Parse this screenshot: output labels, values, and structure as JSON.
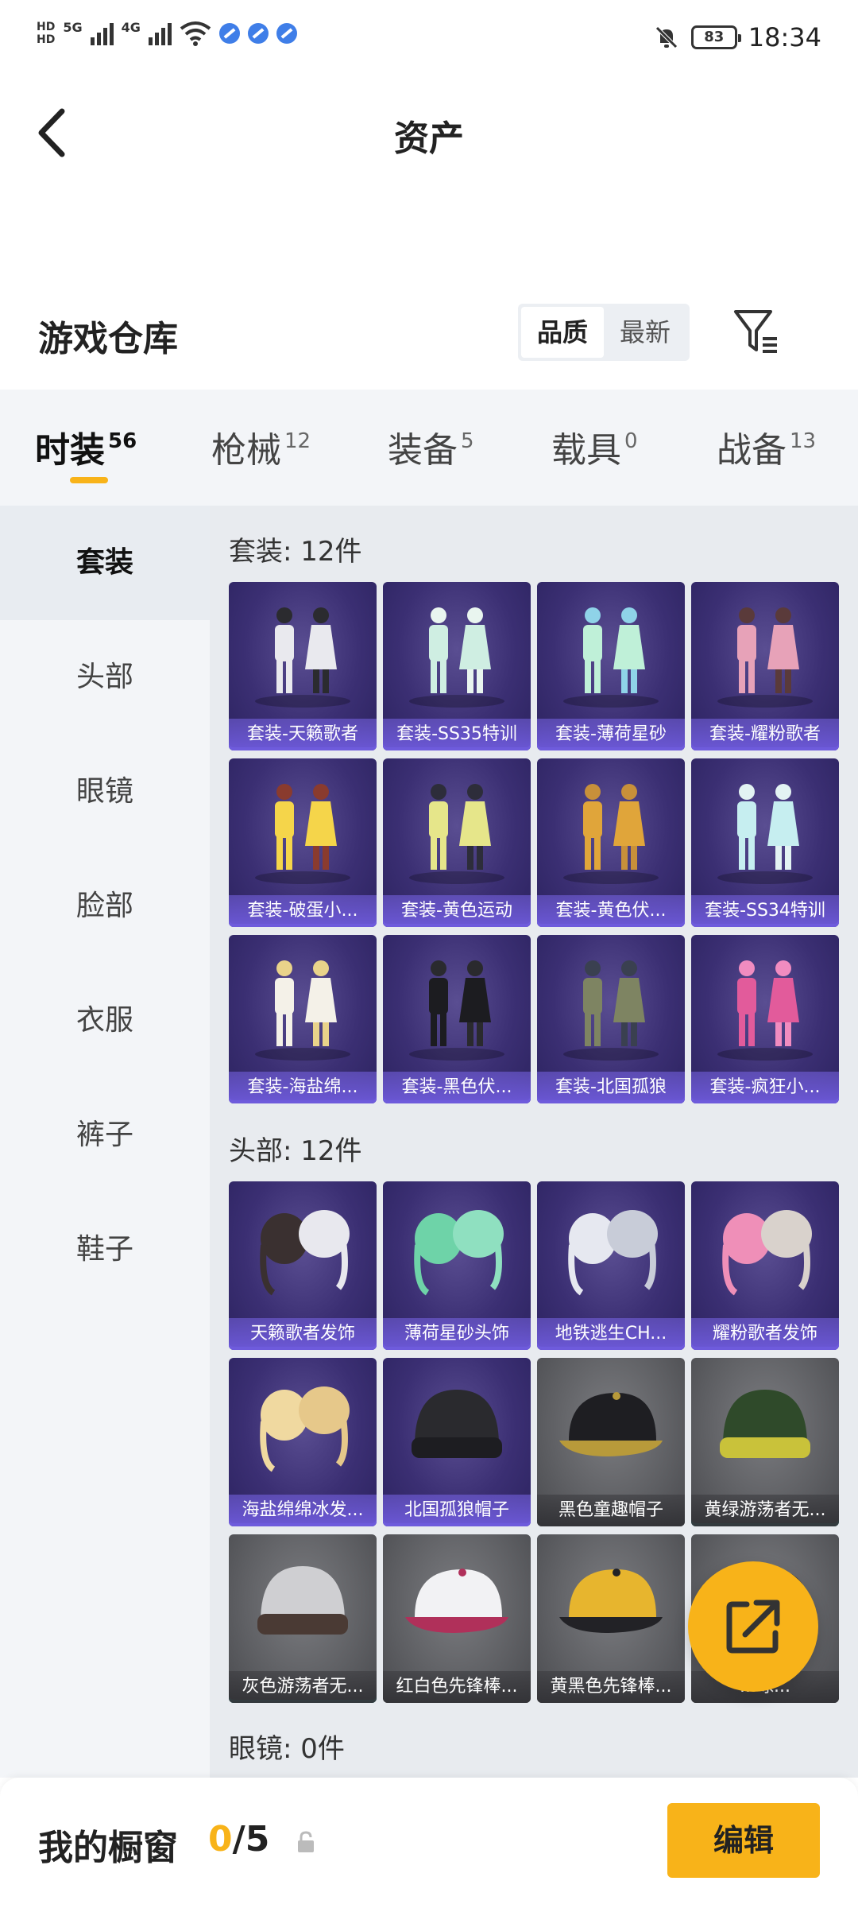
{
  "status_bar": {
    "left_badges": [
      "HD",
      "HD"
    ],
    "network1": "5G",
    "network2": "4G",
    "battery": "83",
    "time": "18:34"
  },
  "header": {
    "title": "资产"
  },
  "warehouse": {
    "title": "游戏仓库",
    "sort_options": [
      "品质",
      "最新"
    ],
    "active_sort": "品质"
  },
  "tabs": [
    {
      "label": "时装",
      "count": "56",
      "active": true
    },
    {
      "label": "枪械",
      "count": "12",
      "active": false
    },
    {
      "label": "装备",
      "count": "5",
      "active": false
    },
    {
      "label": "载具",
      "count": "0",
      "active": false
    },
    {
      "label": "战备",
      "count": "13",
      "active": false
    }
  ],
  "sidebar": {
    "items": [
      {
        "label": "套装",
        "active": true
      },
      {
        "label": "头部",
        "active": false
      },
      {
        "label": "眼镜",
        "active": false
      },
      {
        "label": "脸部",
        "active": false
      },
      {
        "label": "衣服",
        "active": false
      },
      {
        "label": "裤子",
        "active": false
      },
      {
        "label": "鞋子",
        "active": false
      }
    ]
  },
  "sections": [
    {
      "heading": "套装: 12件",
      "items": [
        {
          "label": "套装-天籁歌者",
          "icon": "outfit-white",
          "tier": "purple"
        },
        {
          "label": "套装-SS35特训",
          "icon": "outfit-mint",
          "tier": "purple"
        },
        {
          "label": "套装-薄荷星砂",
          "icon": "outfit-mint-dress",
          "tier": "purple"
        },
        {
          "label": "套装-耀粉歌者",
          "icon": "outfit-pink",
          "tier": "purple"
        },
        {
          "label": "套装-破蛋小...",
          "icon": "outfit-chick",
          "tier": "purple"
        },
        {
          "label": "套装-黄色运动",
          "icon": "outfit-yellow-sport",
          "tier": "purple"
        },
        {
          "label": "套装-黄色伏...",
          "icon": "outfit-yellow-hoodie",
          "tier": "purple"
        },
        {
          "label": "套装-SS34特训",
          "icon": "outfit-light-blue",
          "tier": "purple"
        },
        {
          "label": "套装-海盐绵...",
          "icon": "outfit-seasalt",
          "tier": "purple"
        },
        {
          "label": "套装-黑色伏...",
          "icon": "outfit-black-hoodie",
          "tier": "purple"
        },
        {
          "label": "套装-北国孤狼",
          "icon": "outfit-olive-jacket",
          "tier": "purple"
        },
        {
          "label": "套装-疯狂小...",
          "icon": "outfit-pink-suit",
          "tier": "purple"
        }
      ]
    },
    {
      "heading": "头部: 12件",
      "items": [
        {
          "label": "天籁歌者发饰",
          "icon": "hair-dark-white",
          "tier": "purple"
        },
        {
          "label": "薄荷星砂头饰",
          "icon": "hair-mint",
          "tier": "purple"
        },
        {
          "label": "地铁逃生CH...",
          "icon": "hair-white",
          "tier": "purple"
        },
        {
          "label": "耀粉歌者发饰",
          "icon": "hair-pink",
          "tier": "purple"
        },
        {
          "label": "海盐绵绵冰发...",
          "icon": "hair-blonde",
          "tier": "purple"
        },
        {
          "label": "北国孤狼帽子",
          "icon": "beanie-black",
          "tier": "purple"
        },
        {
          "label": "黑色童趣帽子",
          "icon": "cap-black",
          "tier": "grey-plain"
        },
        {
          "label": "黄绿游荡者无...",
          "icon": "beanie-stripe",
          "tier": "grey"
        },
        {
          "label": "灰色游荡者无...",
          "icon": "beanie-grey",
          "tier": "grey"
        },
        {
          "label": "红白色先锋棒...",
          "icon": "cap-red-white",
          "tier": "grey-plain"
        },
        {
          "label": "黄黑色先锋棒...",
          "icon": "cap-yellow-black",
          "tier": "grey-plain"
        },
        {
          "label": "...球...",
          "icon": "cap-dark",
          "tier": "grey-plain"
        }
      ]
    },
    {
      "heading": "眼镜: 0件",
      "items": []
    }
  ],
  "bottom_bar": {
    "label": "我的橱窗",
    "current": "0",
    "separator": "/",
    "max": "5",
    "edit_label": "编辑"
  },
  "colors": {
    "accent": "#f8b319",
    "card_purple": "#3b2f73",
    "card_grey": "#5e5f63"
  }
}
